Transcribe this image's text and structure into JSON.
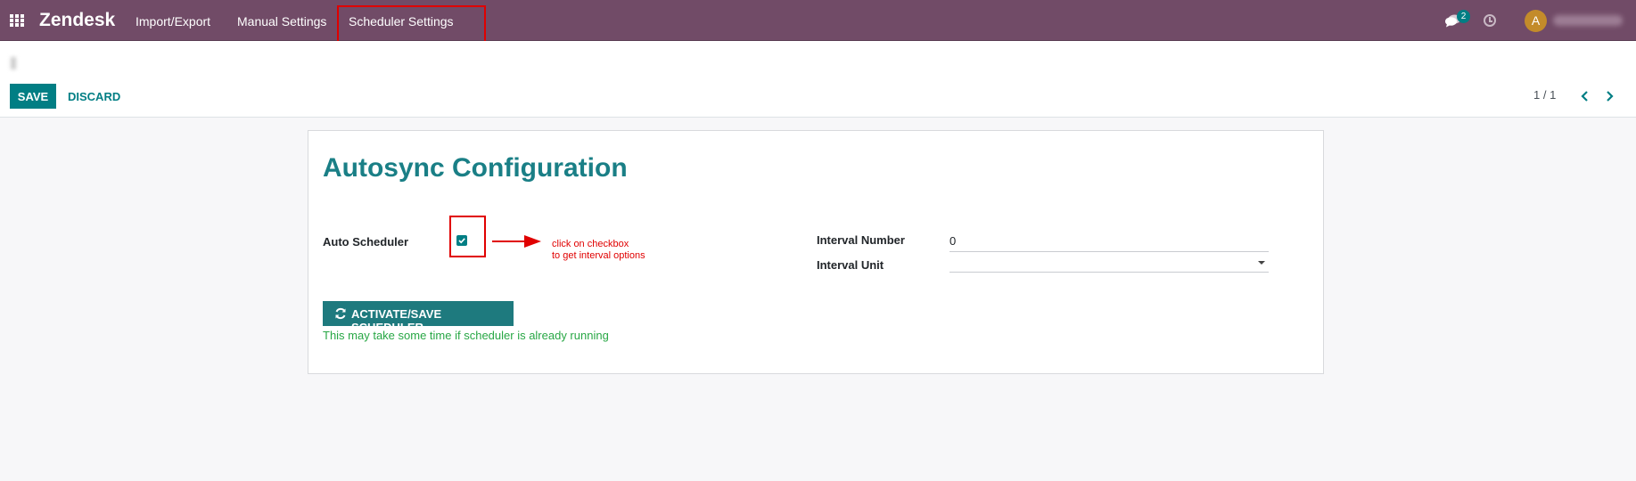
{
  "topbar": {
    "brand": "Zendesk",
    "menu": [
      {
        "label": "Import/Export"
      },
      {
        "label": "Manual Settings"
      },
      {
        "label": "Scheduler Settings"
      }
    ],
    "chat_count": "2",
    "avatar_initial": "A"
  },
  "control_panel": {
    "save_label": "SAVE",
    "discard_label": "DISCARD",
    "pager_value": "1 / 1"
  },
  "form": {
    "title": "Autosync Configuration",
    "auto_scheduler_label": "Auto Scheduler",
    "auto_scheduler_checked": true,
    "annotation_line1": "click on checkbox",
    "annotation_line2": "to get interval options",
    "interval_number_label": "Interval Number",
    "interval_number_value": "0",
    "interval_unit_label": "Interval Unit",
    "interval_unit_value": "",
    "activate_label": "ACTIVATE/SAVE SCHEDULER",
    "help_text": "This may take some time if scheduler is already running"
  },
  "colors": {
    "topbar": "#714b67",
    "primary": "#017e84",
    "title": "#1a7f86",
    "annotation_red": "#e00000",
    "help_green": "#28a745"
  },
  "icons": [
    "apps-grid-icon",
    "chat-icon",
    "clock-icon",
    "chevron-left-icon",
    "chevron-right-icon",
    "check-icon",
    "sync-icon",
    "caret-down-icon"
  ]
}
